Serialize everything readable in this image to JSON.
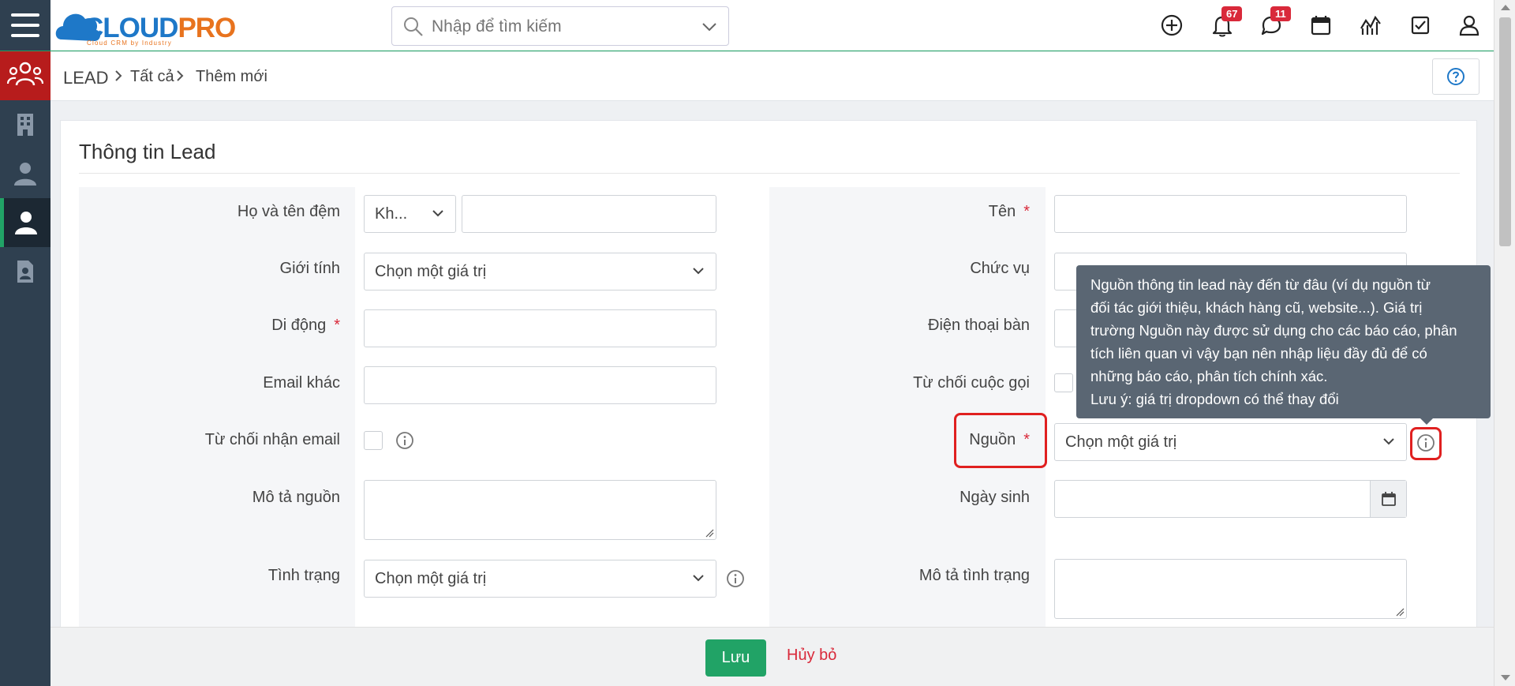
{
  "header": {
    "logo_cloud": "CLOUD",
    "logo_pro": "PRO",
    "logo_tagline": "Cloud CRM by Industry",
    "search_placeholder": "Nhập để tìm kiếm",
    "notifications_count": "67",
    "messages_count": "11",
    "icons": [
      "plus-circle-icon",
      "bell-icon",
      "chat-icon",
      "calendar-icon",
      "chart-icon",
      "checkbox-icon",
      "user-icon"
    ]
  },
  "sidebar": {
    "items": [
      "leads-group-icon",
      "building-icon",
      "contacts-icon",
      "user-icon",
      "document-user-icon"
    ]
  },
  "breadcrumb": {
    "module": "LEAD",
    "all": "Tất cả",
    "current": "Thêm mới"
  },
  "form": {
    "title": "Thông tin Lead",
    "left": {
      "middle_name_label": "Họ và tên đệm",
      "salutation_value": "Kh...",
      "gender_label": "Giới tính",
      "gender_value": "Chọn một giá trị",
      "mobile_label": "Di động",
      "other_email_label": "Email khác",
      "email_opt_out_label": "Từ chối nhận email",
      "source_desc_label": "Mô tả nguồn",
      "status_label": "Tình trạng",
      "status_value": "Chọn một giá trị"
    },
    "right": {
      "first_name_label": "Tên",
      "title_label": "Chức vụ",
      "phone_label": "Điện thoại bàn",
      "do_not_call_label": "Từ chối cuộc gọi",
      "source_label": "Nguồn",
      "source_value": "Chọn một giá trị",
      "birthday_label": "Ngày sinh",
      "status_desc_label": "Mô tả tình trạng"
    },
    "required_mark": "*"
  },
  "tooltip": {
    "line1": "Nguồn thông tin lead này đến từ đâu (ví dụ nguồn từ",
    "line2": "đối tác giới thiệu, khách hàng cũ, website...). Giá trị",
    "line3": "trường Nguồn này được sử dụng cho các báo cáo, phân",
    "line4": "tích liên quan vì vậy bạn nên nhập liệu đầy đủ để có",
    "line5": "những báo cáo, phân tích chính xác.",
    "line6": "Lưu ý: giá trị dropdown có thể thay đổi"
  },
  "footer": {
    "save_label": "Lưu",
    "cancel_label": "Hủy bỏ"
  },
  "colors": {
    "primary_green": "#21a366",
    "danger_red": "#d9293a",
    "sidebar_bg": "#2f4050",
    "tooltip_bg": "#5a6673"
  }
}
